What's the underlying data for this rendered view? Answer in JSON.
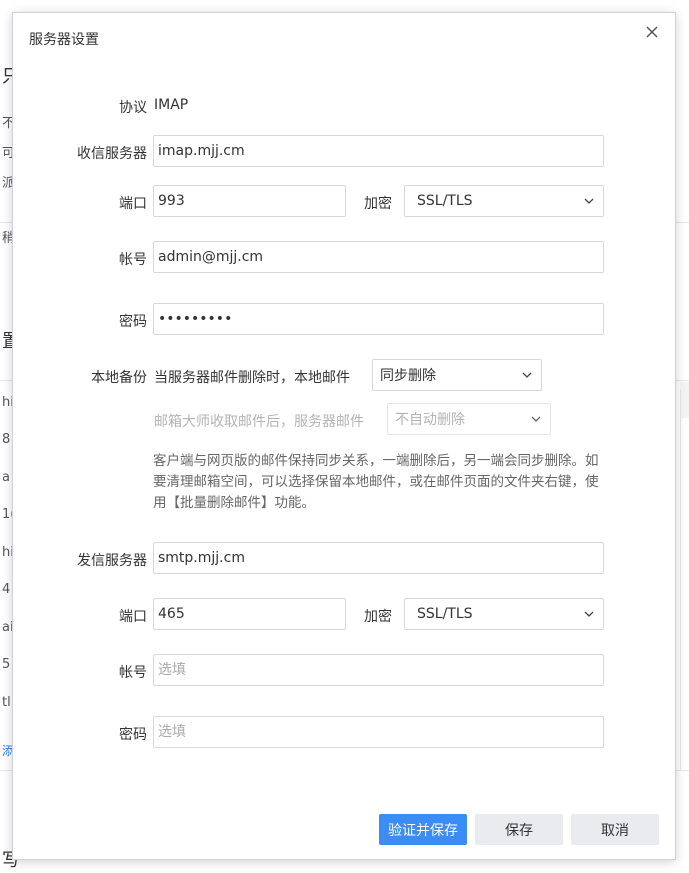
{
  "background": {
    "glyphs": [
      "只",
      "不",
      "可",
      "派",
      "稍",
      "置",
      "hi",
      "8",
      "a",
      "1(",
      "hi",
      "4",
      "ai",
      "5",
      "tl",
      "添",
      "写"
    ]
  },
  "dialog": {
    "title": "服务器设置",
    "close_icon": "close-icon"
  },
  "incoming": {
    "protocol_label": "协议",
    "protocol_value": "IMAP",
    "server_label": "收信服务器",
    "server_value": "imap.mjj.cm",
    "port_label": "端口",
    "port_value": "993",
    "encryption_label": "加密",
    "encryption_value": "SSL/TLS",
    "account_label": "帐号",
    "account_value": "admin@mjj.cm",
    "password_label": "密码",
    "password_value": "•••••••••"
  },
  "backup": {
    "label": "本地备份",
    "when_server_deleted": "当服务器邮件删除时，本地邮件",
    "sync_option": "同步删除",
    "after_receive": "邮箱大师收取邮件后，服务器邮件",
    "auto_delete_option": "不自动删除",
    "note": "客户端与网页版的邮件保持同步关系，一端删除后，另一端会同步删除。如要清理邮箱空间，可以选择保留本地邮件，或在邮件页面的文件夹右键，使用【批量删除邮件】功能。"
  },
  "outgoing": {
    "server_label": "发信服务器",
    "server_value": "smtp.mjj.cm",
    "port_label": "端口",
    "port_value": "465",
    "encryption_label": "加密",
    "encryption_value": "SSL/TLS",
    "account_label": "帐号",
    "account_placeholder": "选填",
    "password_label": "密码",
    "password_placeholder": "选填"
  },
  "footer": {
    "verify_save": "验证并保存",
    "save": "保存",
    "cancel": "取消"
  },
  "colors": {
    "primary": "#3b8cf5",
    "secondary_button": "#e9ebee",
    "link": "#2a7fe0"
  }
}
